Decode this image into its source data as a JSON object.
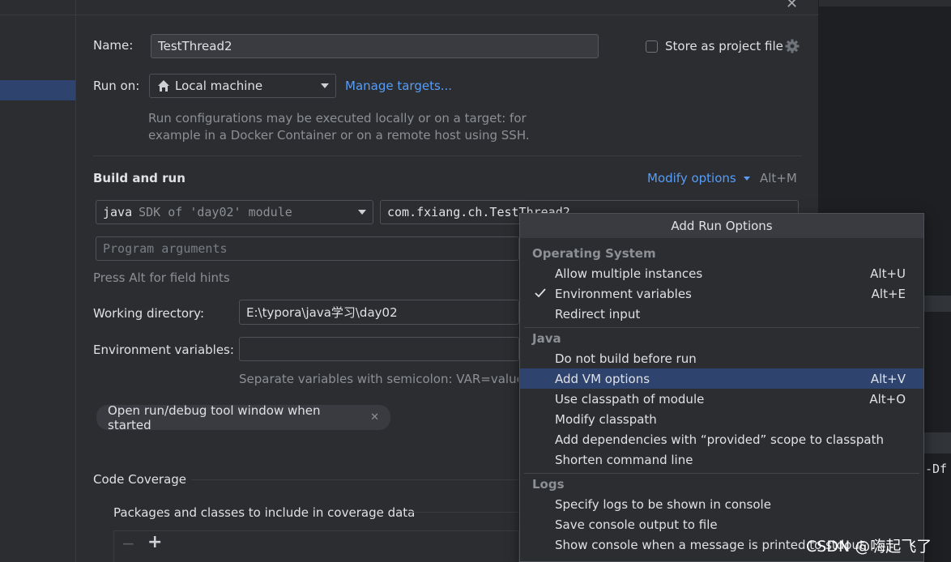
{
  "window": {
    "close_glyph": "✕"
  },
  "config": {
    "name_label": "Name:",
    "name_value": "TestThread2",
    "store_label": "Store as project file",
    "run_on_label": "Run on:",
    "run_on_value": "Local machine",
    "manage_targets": "Manage targets...",
    "run_on_hint_1": "Run configurations may be executed locally or on a target: for",
    "run_on_hint_2": "example in a Docker Container or on a remote host using SSH."
  },
  "build": {
    "title": "Build and run",
    "modify_options": "Modify options",
    "modify_shortcut": "Alt+M",
    "sdk_java": "java",
    "sdk_rest": "SDK of 'day02' module",
    "main_class": "com.fxiang.ch.TestThread2",
    "program_args_placeholder": "Program arguments",
    "field_hint": "Press Alt for field hints",
    "working_dir_label": "Working directory:",
    "working_dir_value": "E:\\typora\\java学习\\day02",
    "env_label": "Environment variables:",
    "env_value": "",
    "env_hint": "Separate variables with semicolon: VAR=value; V",
    "open_tool_window": "Open run/debug tool window when started"
  },
  "coverage": {
    "title": "Code Coverage",
    "packages_label": "Packages and classes to include in coverage data",
    "minus": "−",
    "plus": "+"
  },
  "popup": {
    "title": "Add Run Options",
    "groups": [
      {
        "name": "Operating System",
        "items": [
          {
            "label": "Allow multiple instances",
            "shortcut": "Alt+U",
            "checked": false,
            "selected": false
          },
          {
            "label": "Environment variables",
            "shortcut": "Alt+E",
            "checked": true,
            "selected": false
          },
          {
            "label": "Redirect input",
            "shortcut": "",
            "checked": false,
            "selected": false
          }
        ]
      },
      {
        "name": "Java",
        "items": [
          {
            "label": "Do not build before run",
            "shortcut": "",
            "checked": false,
            "selected": false
          },
          {
            "label": "Add VM options",
            "shortcut": "Alt+V",
            "checked": false,
            "selected": true
          },
          {
            "label": "Use classpath of module",
            "shortcut": "Alt+O",
            "checked": false,
            "selected": false
          },
          {
            "label": "Modify classpath",
            "shortcut": "",
            "checked": false,
            "selected": false
          },
          {
            "label": "Add dependencies with “provided” scope to classpath",
            "shortcut": "",
            "checked": false,
            "selected": false
          },
          {
            "label": "Shorten command line",
            "shortcut": "",
            "checked": false,
            "selected": false
          }
        ]
      },
      {
        "name": "Logs",
        "items": [
          {
            "label": "Specify logs to be shown in console",
            "shortcut": "",
            "checked": false,
            "selected": false
          },
          {
            "label": "Save console output to file",
            "shortcut": "",
            "checked": false,
            "selected": false
          },
          {
            "label": "Show console when a message is printed to stdout",
            "shortcut": "",
            "checked": false,
            "selected": false
          }
        ]
      }
    ]
  },
  "background": {
    "code_fragment": "-Df"
  },
  "watermark": "CSDN @嗨起飞了",
  "colors": {
    "accent": "#589df6",
    "selection": "#2e436e",
    "background": "#2b2d30"
  }
}
